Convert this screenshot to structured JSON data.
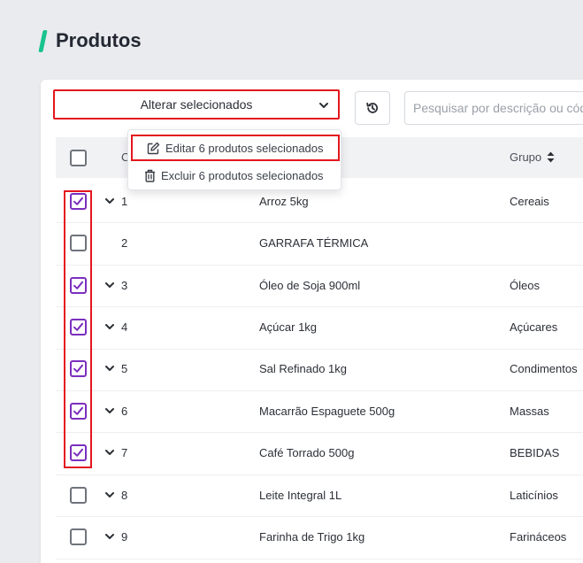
{
  "page": {
    "title": "Produtos"
  },
  "toolbar": {
    "bulk_select_label": "Alterar selecionados",
    "search_placeholder": "Pesquisar por descrição ou código"
  },
  "table": {
    "columns": {
      "code": "C",
      "group": "Grupo"
    },
    "rows": [
      {
        "code": "1",
        "description": "Arroz 5kg",
        "group": "Cereais",
        "checked": true,
        "expandable": true
      },
      {
        "code": "2",
        "description": "GARRAFA TÉRMICA",
        "group": "",
        "checked": false,
        "expandable": false
      },
      {
        "code": "3",
        "description": "Óleo de Soja 900ml",
        "group": "Óleos",
        "checked": true,
        "expandable": true
      },
      {
        "code": "4",
        "description": "Açúcar 1kg",
        "group": "Açúcares",
        "checked": true,
        "expandable": true
      },
      {
        "code": "5",
        "description": "Sal Refinado 1kg",
        "group": "Condimentos",
        "checked": true,
        "expandable": true
      },
      {
        "code": "6",
        "description": "Macarrão Espaguete 500g",
        "group": "Massas",
        "checked": true,
        "expandable": true
      },
      {
        "code": "7",
        "description": "Café Torrado 500g",
        "group": "BEBIDAS",
        "checked": true,
        "expandable": true
      },
      {
        "code": "8",
        "description": "Leite Integral 1L",
        "group": "Laticínios",
        "checked": false,
        "expandable": true
      },
      {
        "code": "9",
        "description": "Farinha de Trigo 1kg",
        "group": "Farináceos",
        "checked": false,
        "expandable": true
      }
    ]
  },
  "dropdown": {
    "edit_label": "Editar 6 produtos selecionados",
    "delete_label": "Excluir 6 produtos selecionados"
  },
  "colors": {
    "accent": "#19c38e",
    "highlight": "#e3171d",
    "checkbox_checked": "#7b2fbe"
  }
}
